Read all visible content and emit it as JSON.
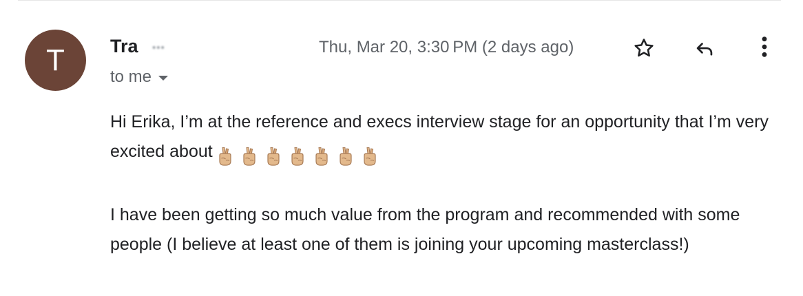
{
  "sender": {
    "avatar_letter": "T",
    "avatar_color": "#6b4437",
    "name": "Tra",
    "email_redacted": "•••",
    "recipient_label": "to me"
  },
  "timestamp": "Thu, Mar 20, 3:30 PM (2 days ago)",
  "actions": {
    "star_icon": "star-icon",
    "reply_icon": "reply-icon",
    "more_icon": "more-vert-icon"
  },
  "message": {
    "paragraph_1": "Hi Erika, I’m at the reference and execs interview stage for an opportunity that I’m very excited about",
    "emoji_name": "crossed-fingers",
    "emoji_count": 7,
    "paragraph_2": "I have been getting so much value from the program and recommended with some people (I believe at least one of them is joining your upcoming masterclass!)"
  }
}
